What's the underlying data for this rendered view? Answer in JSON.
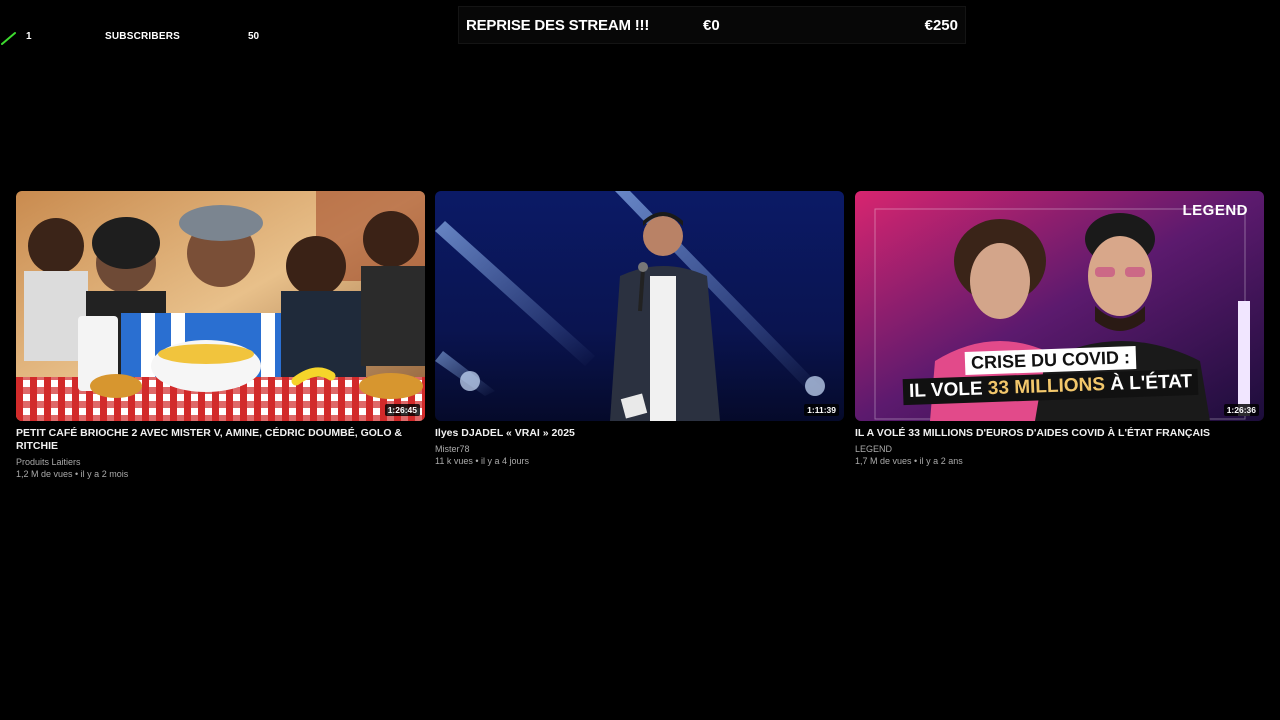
{
  "subscriber_goal": {
    "current": "1",
    "label": "SUBSCRIBERS",
    "goal": "50",
    "accent": "#3ddc2f"
  },
  "donation_goal": {
    "title": "REPRISE DES STREAM !!!",
    "current": "€0",
    "target": "€250"
  },
  "videos": [
    {
      "title": "PETIT CAFÉ BRIOCHE 2 AVEC MISTER V, AMINE, CÉDRIC DOUMBÉ, GOLO & RITCHIE",
      "channel": "Produits Laitiers",
      "meta": "1,2 M de vues • il y a 2 mois",
      "duration": "1:26:45"
    },
    {
      "title": "Ilyes DJADEL « VRAI » 2025",
      "channel": "Mister78",
      "meta": "11 k vues • il y a 4 jours",
      "duration": "1:11:39"
    },
    {
      "title": "IL A VOLÉ 33 MILLIONS D'EUROS D'AIDES COVID À L'ÉTAT FRANÇAIS",
      "channel": "LEGEND",
      "meta": "1,7 M de vues • il y a 2 ans",
      "duration": "1:26:36",
      "thumb_text": {
        "brand": "LEGEND",
        "line1_a": "CRISE DU ",
        "line1_b": "COVID :",
        "line2_a": "IL VOLE ",
        "line2_b": "33 MILLIONS",
        "line2_c": " À L'ÉTAT"
      }
    }
  ]
}
